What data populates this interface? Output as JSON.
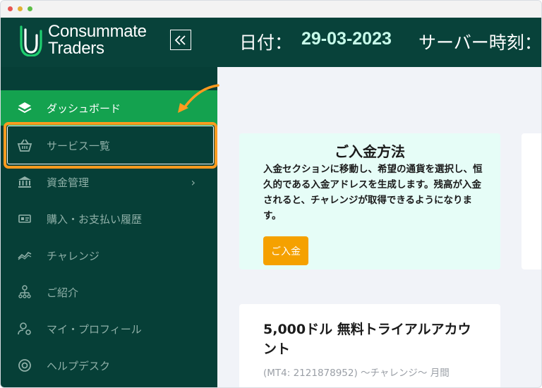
{
  "app": {
    "brand_line1": "Consummate",
    "brand_line2": "Traders"
  },
  "header": {
    "date_label": "日付：",
    "date_value": "29-03-2023",
    "server_time_label": "サーバー時刻："
  },
  "sidebar": {
    "items": [
      {
        "label": "ダッシュボード",
        "icon": "layers-icon"
      },
      {
        "label": "サービス一覧",
        "icon": "basket-icon"
      },
      {
        "label": "資金管理",
        "icon": "bank-icon"
      },
      {
        "label": "購入・お支払い履歴",
        "icon": "id-card-icon"
      },
      {
        "label": "チャレンジ",
        "icon": "trend-icon"
      },
      {
        "label": "ご紹介",
        "icon": "referral-icon"
      },
      {
        "label": "マイ・プロフィール",
        "icon": "user-settings-icon"
      },
      {
        "label": "ヘルプデスク",
        "icon": "lifebuoy-icon"
      }
    ],
    "chevron": "›"
  },
  "deposit_card": {
    "title": "ご入金方法",
    "body": "入金セクションに移動し、希望の通貨を選択し、恒久的である入金アドレスを生成します。残高が入金されると、チャレンジが取得できるようになります。",
    "button": "ご入金"
  },
  "trial_card": {
    "title": "5,000ドル 無料トライアルアカウント",
    "subtitle": "(MT4: 2121878952) 〜チャレンジ〜 月間"
  },
  "colors": {
    "header_bg": "#08423a",
    "sidebar_bg": "#063f37",
    "active_item": "#14a24f",
    "highlight": "#ff9a1f",
    "deposit_button": "#f5a100",
    "date_value": "#c7fbea"
  }
}
